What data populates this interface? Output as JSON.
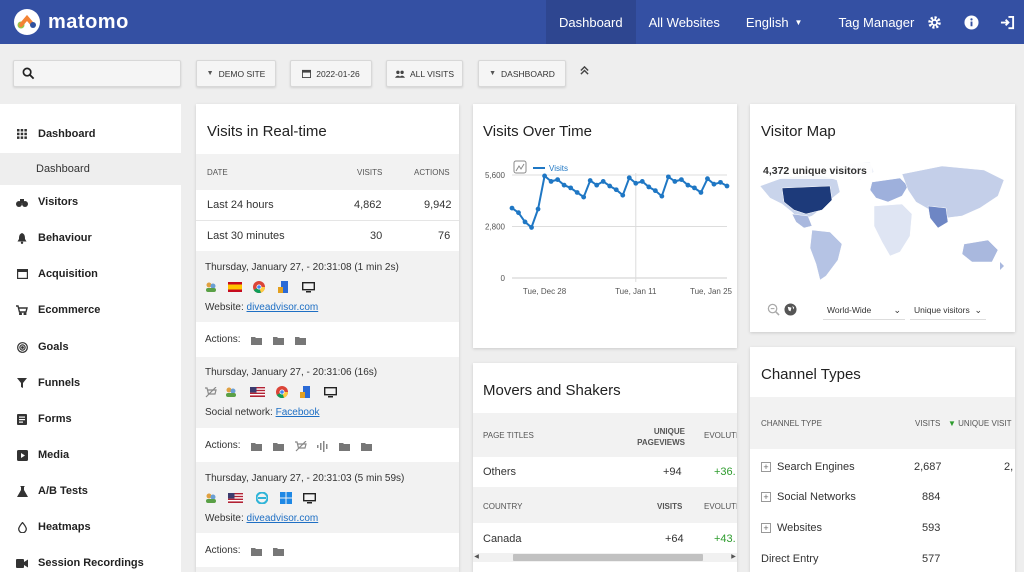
{
  "brand": {
    "name": "matomo"
  },
  "nav": {
    "items": [
      "Dashboard",
      "All Websites",
      "English",
      "Tag Manager"
    ]
  },
  "controls": {
    "site": "DEMO SITE",
    "date": "2022-01-26",
    "segment": "ALL VISITS",
    "dashboard": "DASHBOARD"
  },
  "sidebar": {
    "items": [
      "Dashboard",
      "Visitors",
      "Behaviour",
      "Acquisition",
      "Ecommerce",
      "Goals",
      "Funnels",
      "Forms",
      "Media",
      "A/B Tests",
      "Heatmaps",
      "Session Recordings"
    ],
    "sub": "Dashboard"
  },
  "realtime": {
    "title": "Visits in Real-time",
    "headers": [
      "DATE",
      "VISITS",
      "ACTIONS"
    ],
    "rows": [
      {
        "label": "Last 24 hours",
        "visits": "4,862",
        "actions": "9,942"
      },
      {
        "label": "Last 30 minutes",
        "visits": "30",
        "actions": "76"
      }
    ],
    "visits": [
      {
        "time": "Thursday, January 27, - 20:31:08 (1 min 2s)",
        "source_label": "Website:",
        "source": "diveadvisor.com",
        "actions": "Actions:"
      },
      {
        "time": "Thursday, January 27, - 20:31:06 (16s)",
        "source_label": "Social network:",
        "source": "Facebook",
        "actions": "Actions:"
      },
      {
        "time": "Thursday, January 27, - 20:31:03 (5 min 59s)",
        "source_label": "Website:",
        "source": "diveadvisor.com",
        "actions": "Actions:"
      }
    ]
  },
  "visits_over_time": {
    "title": "Visits Over Time",
    "legend": "Visits",
    "yticks": [
      "5,600",
      "2,800",
      "0"
    ],
    "xticks": [
      "Tue, Dec 28",
      "Tue, Jan 11",
      "Tue, Jan 25"
    ]
  },
  "chart_data": {
    "type": "line",
    "title": "Visits Over Time",
    "series": [
      {
        "name": "Visits",
        "values": [
          3800,
          3550,
          3050,
          2750,
          3750,
          5550,
          5250,
          5350,
          5050,
          4900,
          4650,
          4400,
          5300,
          5050,
          5250,
          5000,
          4800,
          4500,
          5450,
          5150,
          5250,
          4950,
          4750,
          4450,
          5500,
          5250,
          5350,
          5050,
          4900,
          4650,
          5400,
          5100,
          5200,
          5000
        ]
      }
    ],
    "x_start": "2021-12-23",
    "xticks": [
      "Tue, Dec 28",
      "Tue, Jan 11",
      "Tue, Jan 25"
    ],
    "ylim": [
      0,
      5600
    ],
    "grid": true,
    "legend": "top-left"
  },
  "movers": {
    "title": "Movers and Shakers",
    "h1": {
      "label": "PAGE TITLES",
      "col2": "UNIQUE PAGEVIEWS",
      "col3": "EVOLUTI"
    },
    "r1": {
      "label": "Others",
      "v2": "+94",
      "v3": "+36."
    },
    "h2": {
      "label": "COUNTRY",
      "col2": "VISITS",
      "col3": "EVOLUTI"
    },
    "r2": {
      "label": "Canada",
      "v2": "+64",
      "v3": "+43."
    }
  },
  "visitor_map": {
    "title": "Visitor Map",
    "summary": "4,372 unique visitors",
    "region": "World-Wide",
    "metric": "Unique visitors"
  },
  "channels": {
    "title": "Channel Types",
    "headers": [
      "CHANNEL TYPE",
      "VISITS",
      "UNIQUE VISIT"
    ],
    "rows": [
      {
        "label": "Search Engines",
        "visits": "2,687",
        "uv": "2,"
      },
      {
        "label": "Social Networks",
        "visits": "884",
        "uv": ""
      },
      {
        "label": "Websites",
        "visits": "593",
        "uv": ""
      },
      {
        "label": "Direct Entry",
        "visits": "577",
        "uv": ""
      }
    ]
  },
  "colors": {
    "nav": "#3450a3",
    "line": "#1f77c4",
    "map_us": "#1d3a7a",
    "link": "#1e6fc4",
    "positive": "#2e9c2e"
  }
}
